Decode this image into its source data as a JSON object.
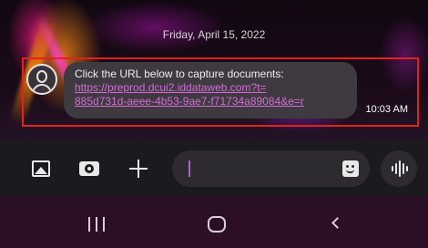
{
  "conversation": {
    "date_separator": "Friday, April 15, 2022",
    "message": {
      "text": "Click the URL below to capture documents:",
      "link_line1": "https://preprod.dcui2.iddataweb.com?t=",
      "link_line2": "885d731d-aeee-4b53-9ae7-f71734a89084&e=r",
      "time": "10:03 AM",
      "sender_avatar_icon": "person-icon"
    }
  },
  "composer": {
    "buttons": [
      {
        "name": "gallery",
        "icon": "image-icon"
      },
      {
        "name": "camera",
        "icon": "camera-icon"
      },
      {
        "name": "add",
        "icon": "plus-icon"
      }
    ],
    "input": {
      "value": "",
      "placeholder": ""
    },
    "sticker_icon": "sticker-icon",
    "voice_icon": "voice-waveform-icon"
  },
  "navigation": {
    "recents_icon": "recents-icon",
    "home_icon": "home-icon",
    "back_icon": "back-icon"
  },
  "colors": {
    "highlight_border": "#e3211f",
    "link": "#d46ad8",
    "cursor": "#b05bd6",
    "nav_bar": "#2b0f25"
  }
}
